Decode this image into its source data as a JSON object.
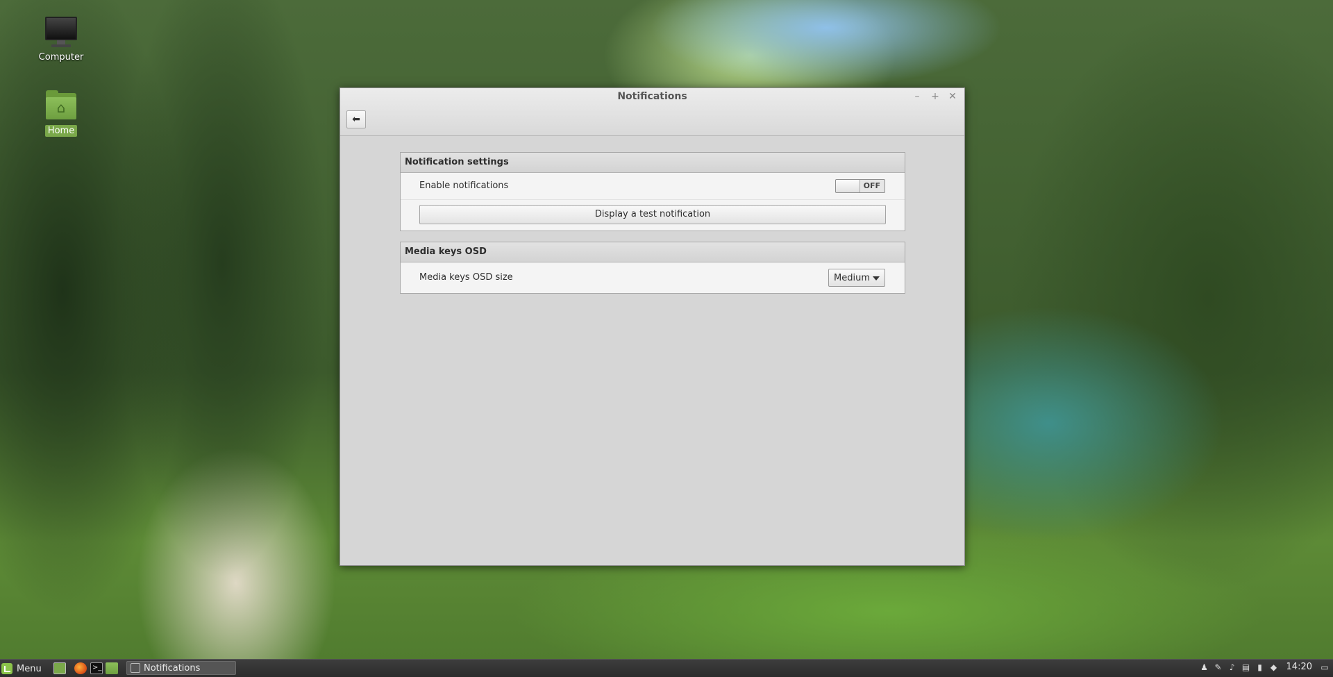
{
  "desktop": {
    "icons": [
      {
        "label": "Computer",
        "icon": "computer-icon"
      },
      {
        "label": "Home",
        "icon": "home-folder-icon"
      }
    ]
  },
  "window": {
    "title": "Notifications",
    "back_icon": "arrow-left-icon",
    "sections": {
      "notification_settings": {
        "header": "Notification settings",
        "enable_label": "Enable notifications",
        "enable_state": "OFF",
        "test_button": "Display a test notification"
      },
      "media_keys": {
        "header": "Media keys OSD",
        "size_label": "Media keys OSD size",
        "size_value": "Medium"
      }
    }
  },
  "taskbar": {
    "menu_label": "Menu",
    "task_title": "Notifications",
    "clock": "14:20"
  }
}
